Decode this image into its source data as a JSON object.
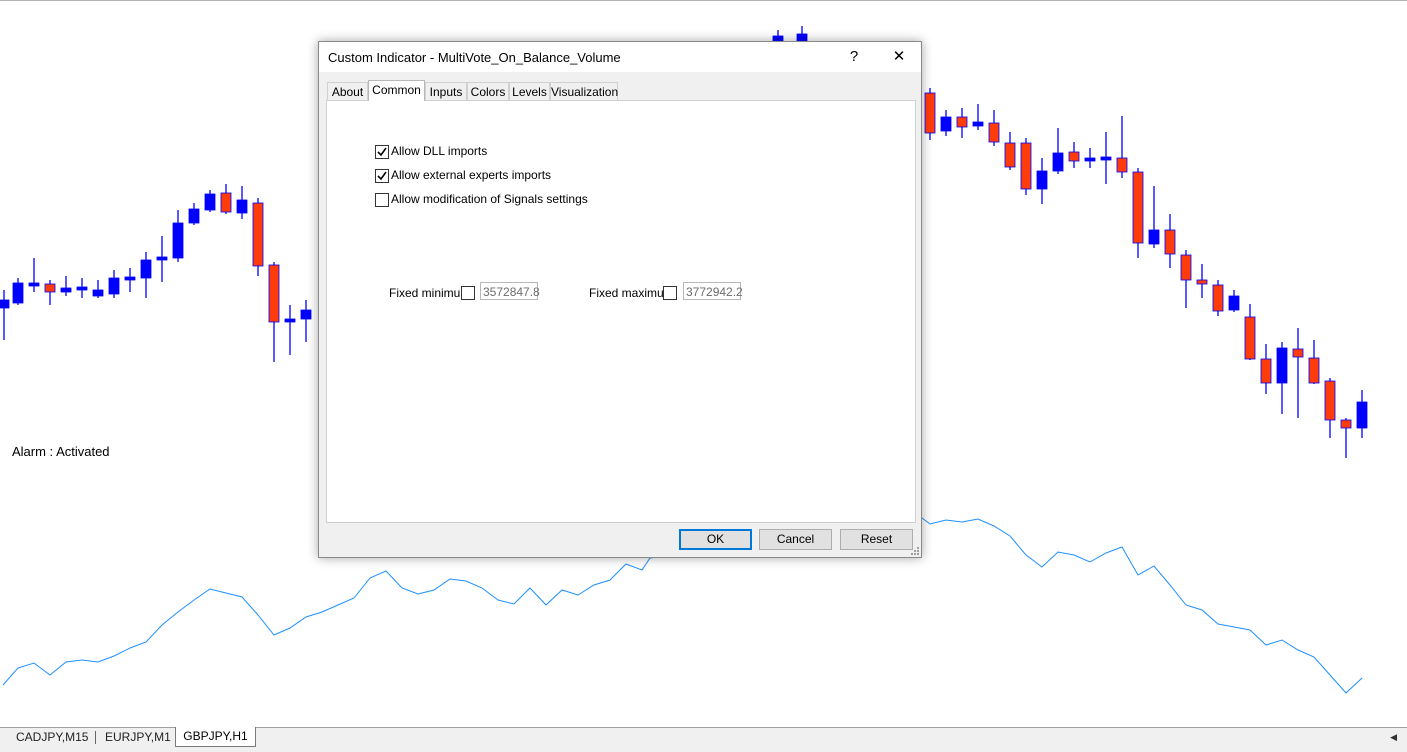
{
  "chart": {
    "alarm_text": "Alarm : Activated",
    "bull_color": "#0000ff",
    "bear_color": "#ff3c0a",
    "line_color": "#1e90ff",
    "wick_color": "#0000ff"
  },
  "symbol_tabs": [
    {
      "label": "CADJPY,M15",
      "active": false
    },
    {
      "label": "EURJPY,M1",
      "active": false
    },
    {
      "label": "GBPJPY,H1",
      "active": true
    }
  ],
  "dialog": {
    "title": "Custom Indicator - MultiVote_On_Balance_Volume",
    "help_label": "?",
    "close_label": "✕",
    "tabs": [
      "About",
      "Common",
      "Inputs",
      "Colors",
      "Levels",
      "Visualization"
    ],
    "active_tab": "Common",
    "options": [
      {
        "label": "Allow DLL imports",
        "checked": true
      },
      {
        "label": "Allow external experts imports",
        "checked": true
      },
      {
        "label": "Allow modification of Signals settings",
        "checked": false
      }
    ],
    "fixed_minimum": {
      "label": "Fixed minimum",
      "checked": false,
      "value": "3572847.8"
    },
    "fixed_maximum": {
      "label": "Fixed maximum",
      "checked": false,
      "value": "3772942.2"
    },
    "buttons": {
      "ok": "OK",
      "cancel": "Cancel",
      "reset": "Reset"
    }
  }
}
